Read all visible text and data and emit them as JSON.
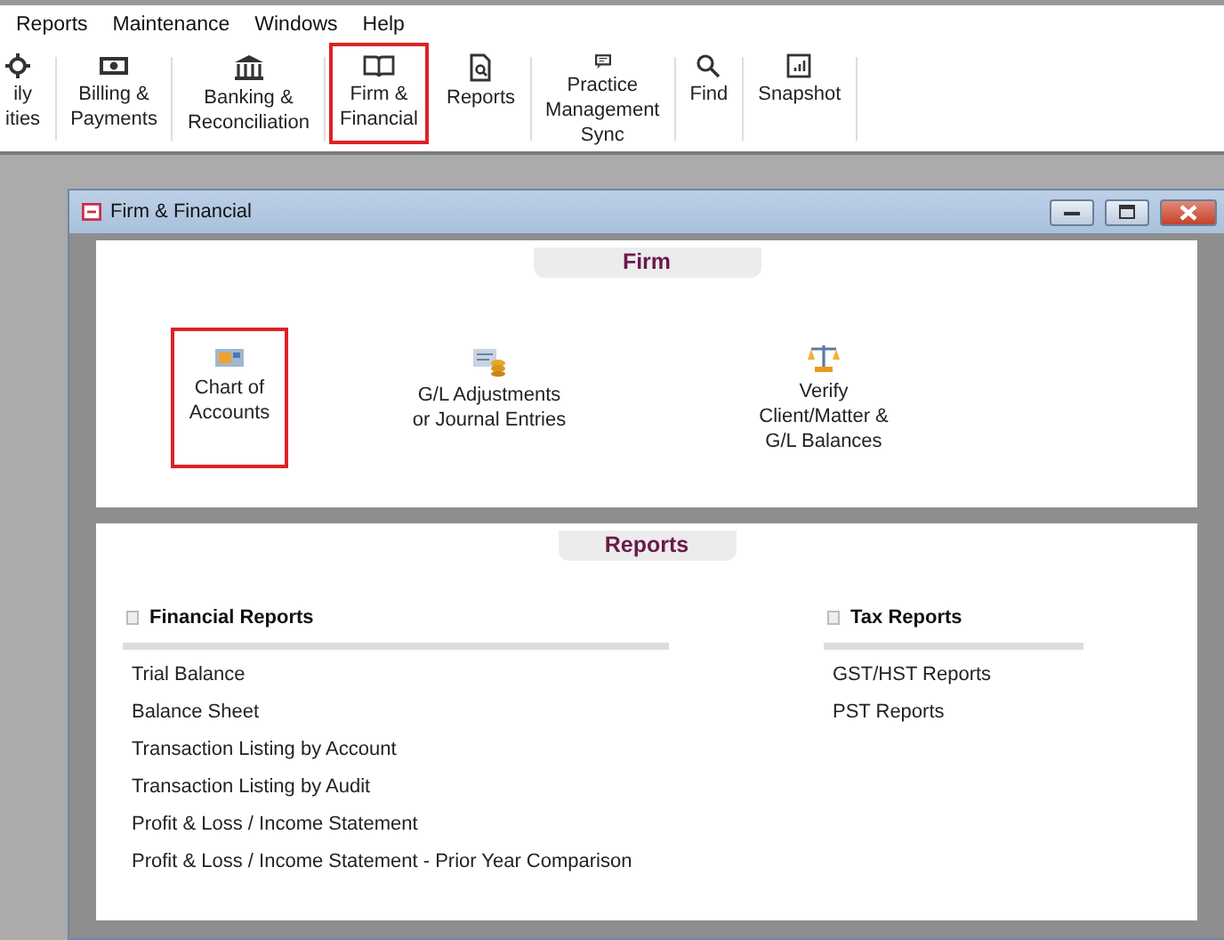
{
  "menu": [
    {
      "label": "Reports"
    },
    {
      "label": "Maintenance"
    },
    {
      "label": "Windows"
    },
    {
      "label": "Help"
    }
  ],
  "toolbar": [
    {
      "lines": [
        "ily",
        "ities"
      ],
      "highlighted": false
    },
    {
      "lines": [
        "Billing &",
        "Payments"
      ],
      "highlighted": false
    },
    {
      "lines": [
        "Banking &",
        "Reconciliation"
      ],
      "highlighted": false
    },
    {
      "lines": [
        "Firm &",
        "Financial"
      ],
      "highlighted": true
    },
    {
      "lines": [
        "Reports"
      ],
      "highlighted": false
    },
    {
      "lines": [
        "Practice",
        "Management",
        "Sync"
      ],
      "highlighted": false
    },
    {
      "lines": [
        "Find"
      ],
      "highlighted": false
    },
    {
      "lines": [
        "Snapshot"
      ],
      "highlighted": false
    }
  ],
  "window": {
    "title": "Firm & Financial",
    "firm": {
      "heading": "Firm",
      "items": [
        {
          "lines": [
            "Chart of",
            "Accounts"
          ],
          "highlighted": true
        },
        {
          "lines": [
            "G/L Adjustments",
            "or Journal Entries"
          ],
          "highlighted": false
        },
        {
          "lines": [
            "Verify",
            "Client/Matter &",
            "G/L Balances"
          ],
          "highlighted": false
        }
      ]
    },
    "reports": {
      "heading": "Reports",
      "groups": [
        {
          "title": "Financial Reports",
          "items": [
            "Trial Balance",
            "Balance Sheet",
            "Transaction Listing by Account",
            "Transaction Listing by Audit",
            "Profit & Loss / Income Statement",
            "Profit & Loss / Income Statement - Prior Year Comparison"
          ]
        },
        {
          "title": "Tax Reports",
          "items": [
            "GST/HST Reports",
            "PST Reports"
          ]
        }
      ]
    }
  }
}
